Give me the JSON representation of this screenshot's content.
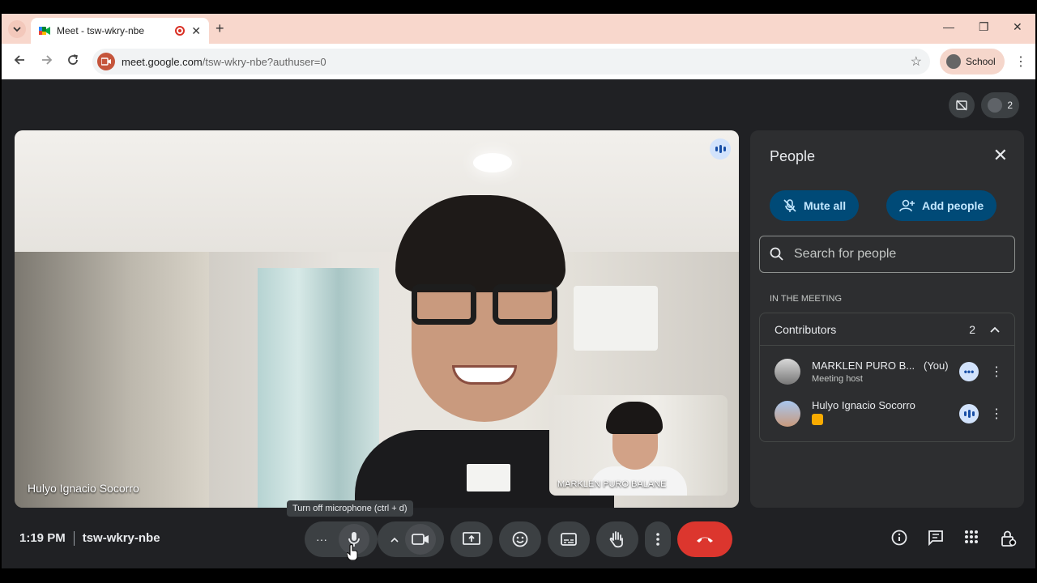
{
  "browser": {
    "tab_title": "Meet - tsw-wkry-nbe",
    "new_tab": "+",
    "url_host": "meet.google.com",
    "url_path": "/tsw-wkry-nbe?authuser=0",
    "profile_label": "School",
    "minimize": "—",
    "restore": "❐",
    "close": "✕",
    "tab_close": "✕"
  },
  "meet": {
    "participant_count": "2",
    "main_tile_name": "Hulyo Ignacio Socorro",
    "self_tile_name": "MARKLEN PURO BALANE"
  },
  "people_panel": {
    "title": "People",
    "mute_all": "Mute all",
    "add_people": "Add people",
    "search_placeholder": "Search for people",
    "section_label": "IN THE MEETING",
    "group_label": "Contributors",
    "group_count": "2",
    "participants": [
      {
        "name": "MARKLEN PURO B...",
        "you": "(You)",
        "role": "Meeting host"
      },
      {
        "name": "Hulyo Ignacio Socorro",
        "you": "",
        "role": ""
      }
    ]
  },
  "bottom_bar": {
    "time": "1:19 PM",
    "meeting_code": "tsw-wkry-nbe",
    "tooltip": "Turn off microphone (ctrl + d)",
    "more_dots": "···"
  },
  "colors": {
    "accent_blue": "#004a77",
    "end_call": "#dc362e",
    "speaking_badge": "#d2e3fc"
  }
}
